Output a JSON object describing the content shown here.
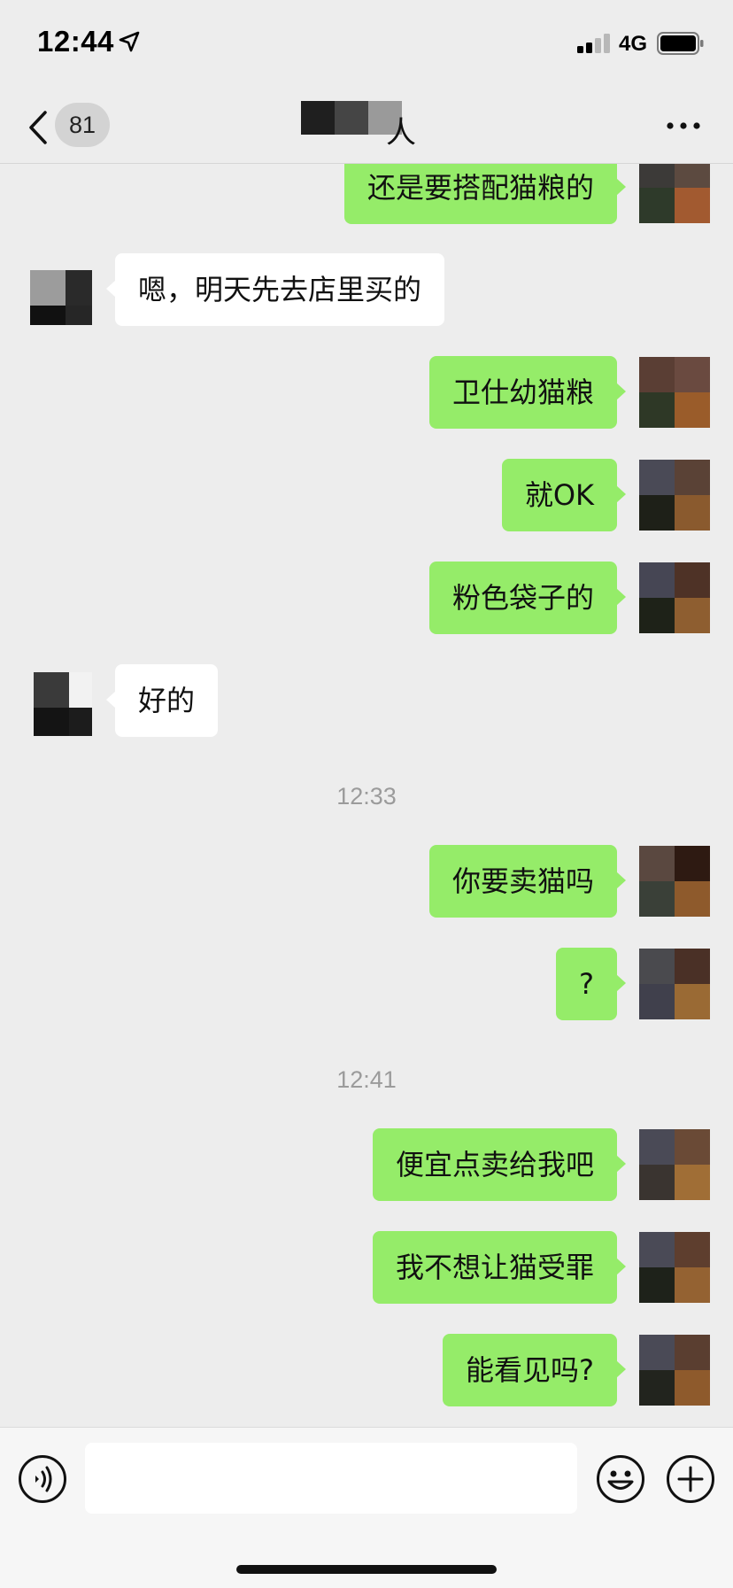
{
  "status_bar": {
    "time": "12:44",
    "location_icon": "location-arrow-icon",
    "network": "4G",
    "signal_icon": "cellular-signal-icon",
    "battery_icon": "battery-icon"
  },
  "nav": {
    "back_icon": "chevron-left-icon",
    "unread_count": "81",
    "title_visible_suffix": "人",
    "more_icon": "ellipsis-icon"
  },
  "messages": [
    {
      "type": "message",
      "sender": "me",
      "text": "还是要搭配猫粮的"
    },
    {
      "type": "message",
      "sender": "other",
      "text": "嗯，明天先去店里买的"
    },
    {
      "type": "message",
      "sender": "me",
      "text": "卫仕幼猫粮"
    },
    {
      "type": "message",
      "sender": "me",
      "text": "就OK"
    },
    {
      "type": "message",
      "sender": "me",
      "text": "粉色袋子的"
    },
    {
      "type": "message",
      "sender": "other",
      "text": "好的"
    },
    {
      "type": "time",
      "text": "12:33"
    },
    {
      "type": "message",
      "sender": "me",
      "text": "你要卖猫吗"
    },
    {
      "type": "message",
      "sender": "me",
      "text": "?"
    },
    {
      "type": "time",
      "text": "12:41"
    },
    {
      "type": "message",
      "sender": "me",
      "text": "便宜点卖给我吧"
    },
    {
      "type": "message",
      "sender": "me",
      "text": "我不想让猫受罪"
    },
    {
      "type": "message",
      "sender": "me",
      "text": "能看见吗?"
    }
  ],
  "input_bar": {
    "voice_icon": "voice-icon",
    "text_value": "",
    "emoji_icon": "emoji-icon",
    "plus_icon": "plus-circle-icon"
  },
  "colors": {
    "background": "#ededed",
    "my_bubble": "#95ec69",
    "their_bubble": "#ffffff",
    "timestamp_text": "#9b9b9b"
  }
}
